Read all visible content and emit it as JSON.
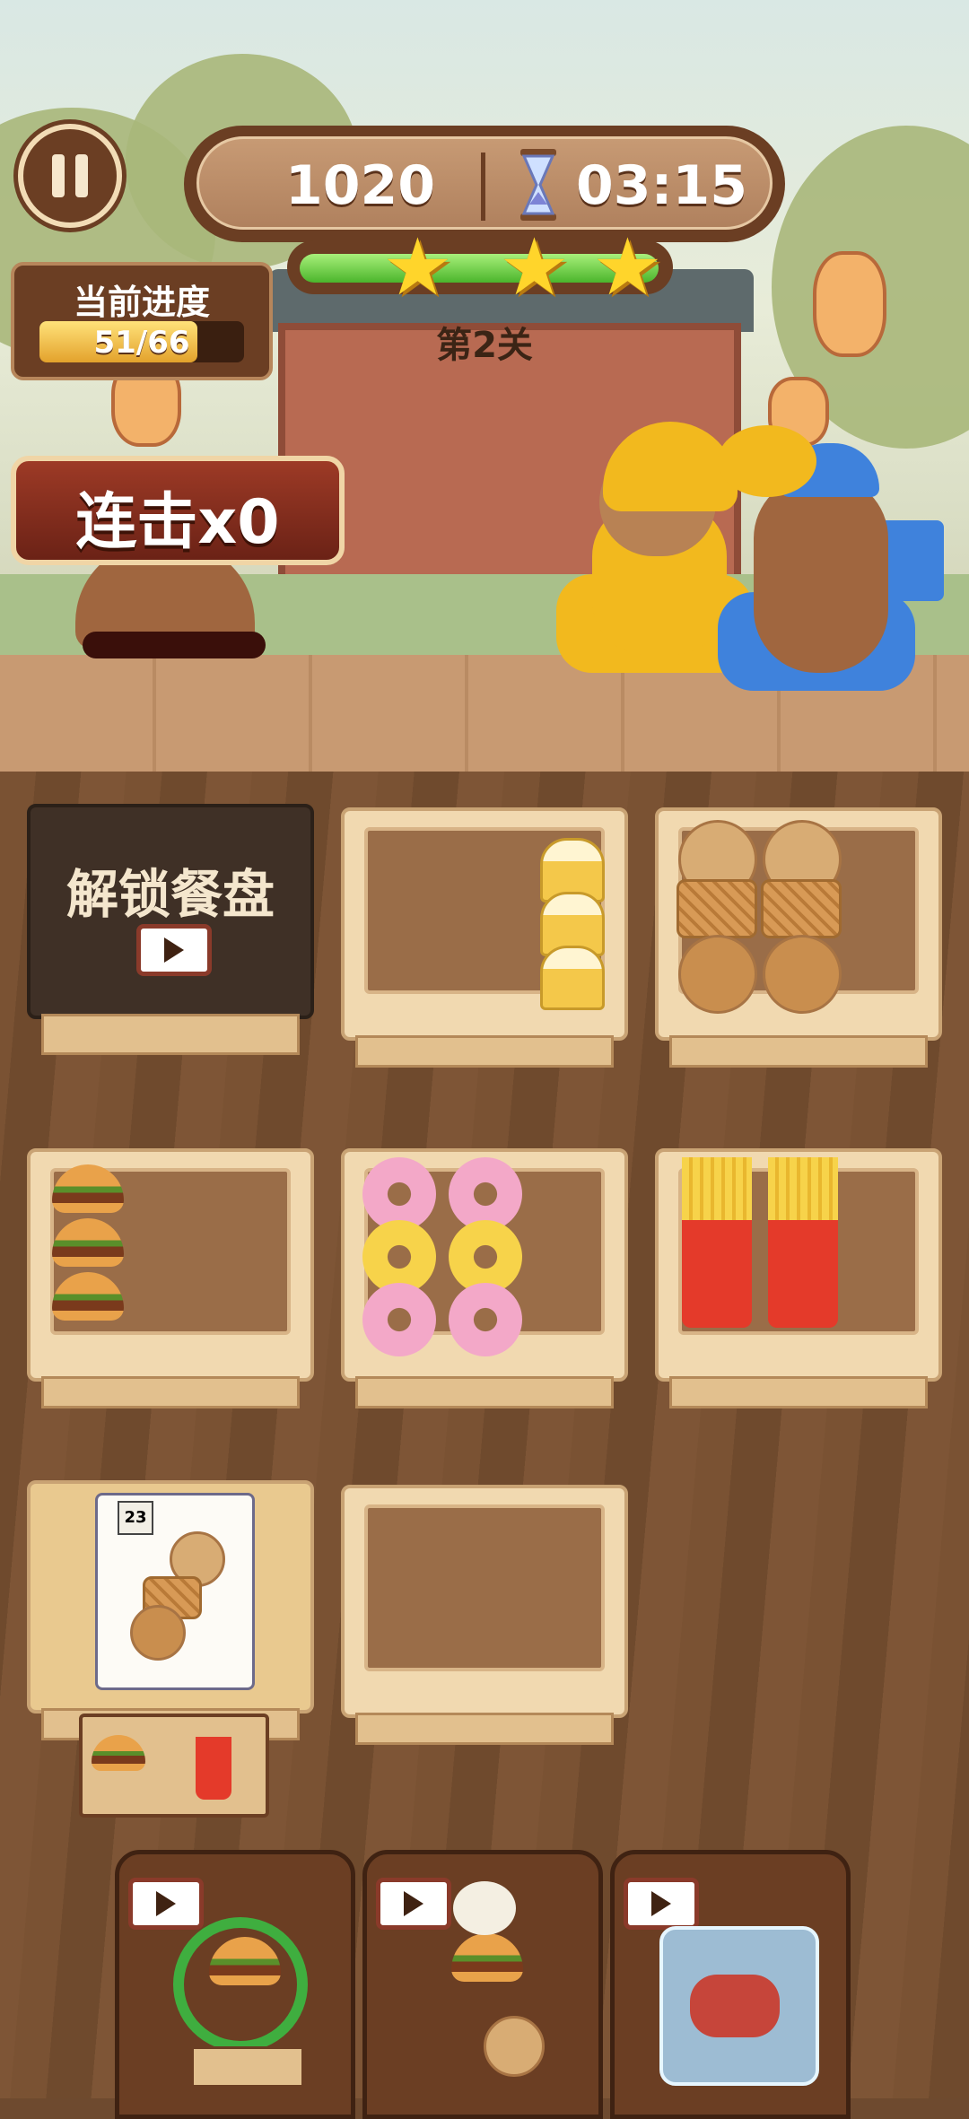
{
  "hud": {
    "score": "1020",
    "timer": "03:15",
    "stars_earned": 3,
    "level_label": "第2关",
    "progress_title": "当前进度",
    "progress_text": "51/66",
    "progress_fraction": 0.773,
    "combo_label": "连击x0"
  },
  "board": {
    "unlock_label": "解锁餐盘",
    "trays": [
      {
        "slot": "r1c1",
        "state": "locked"
      },
      {
        "slot": "r1c2",
        "items": [
          "pudding",
          "pudding",
          "pudding"
        ]
      },
      {
        "slot": "r1c3",
        "items": [
          "cookie",
          "cookie",
          "waffle",
          "waffle",
          "waffle-cookie",
          "waffle-cookie"
        ]
      },
      {
        "slot": "r2c1",
        "items": [
          "burger",
          "burger",
          "burger"
        ]
      },
      {
        "slot": "r2c2",
        "items": [
          "pink-donut",
          "pink-donut",
          "yellow-donut",
          "yellow-donut",
          "pink-donut",
          "pink-donut"
        ]
      },
      {
        "slot": "r2c3",
        "items": [
          "fries",
          "fries"
        ]
      },
      {
        "slot": "r3c1",
        "state": "order-notebook"
      },
      {
        "slot": "r3c2",
        "items": []
      }
    ],
    "notebook_date": "23"
  },
  "boosters": [
    {
      "name": "swap-tray-booster",
      "icon": "video-ad-icon"
    },
    {
      "name": "shuffle-booster",
      "icon": "video-ad-icon"
    },
    {
      "name": "freeze-booster",
      "icon": "video-ad-icon"
    }
  ],
  "colors": {
    "hud_brown": "#6b3e23",
    "progress_green": "#4bb52c",
    "star_gold": "#ffd52b",
    "combo_red": "#9d3a26",
    "tray_wood": "#9a6d48"
  }
}
